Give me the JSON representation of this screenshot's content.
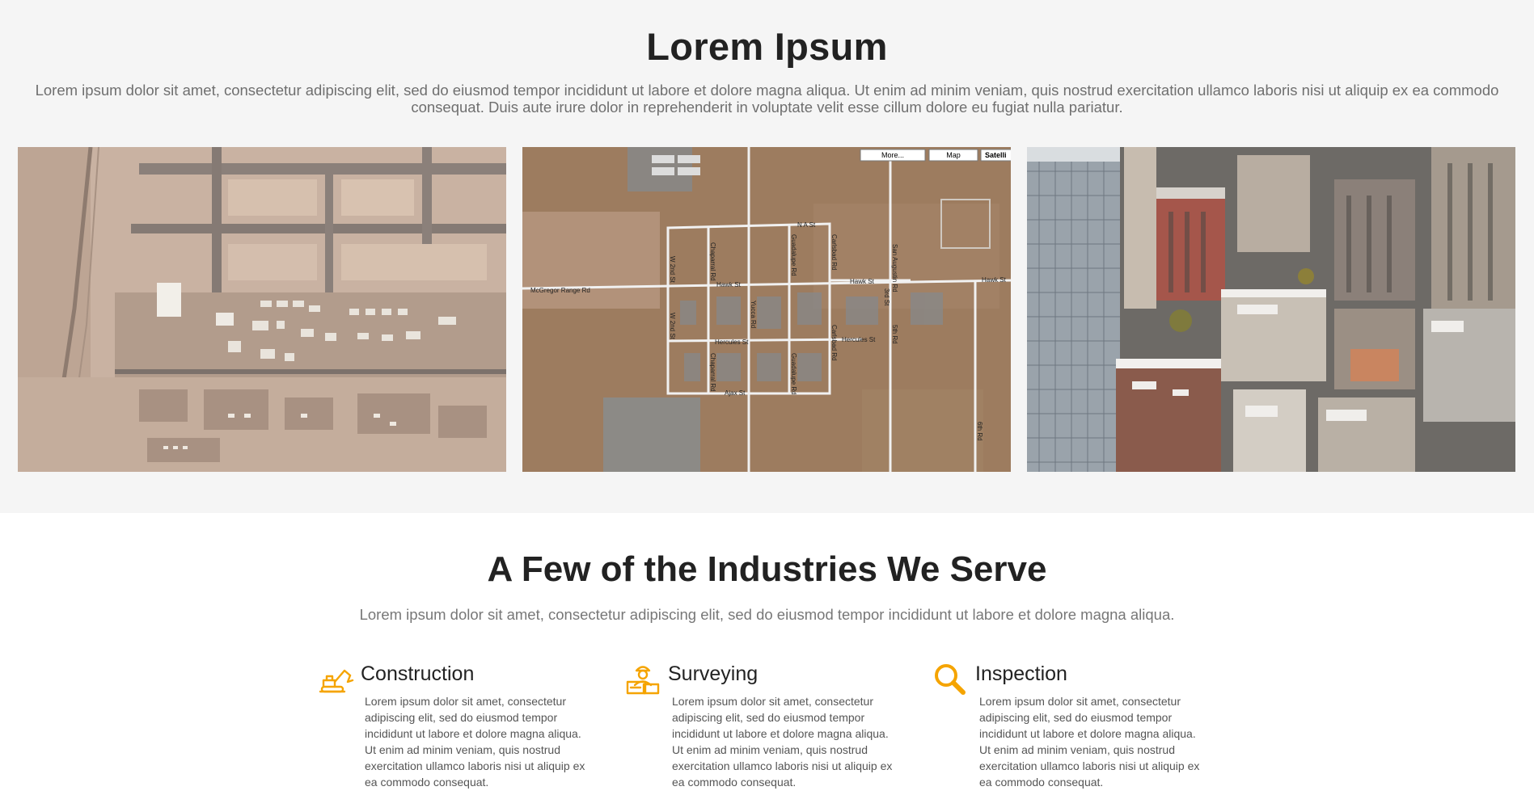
{
  "hero": {
    "title": "Lorem Ipsum",
    "text": "Lorem ipsum dolor sit amet, consectetur adipiscing elit, sed do eiusmod tempor incididunt ut labore et dolore magna aliqua. Ut enim ad minim veniam, quis nostrud exercitation ullamco laboris nisi ut aliquip ex ea commodo consequat. Duis aute irure dolor in reprehenderit in voluptate velit esse cillum dolore eu fugiat nulla pariatur."
  },
  "gallery": {
    "map": {
      "buttons": [
        "More...",
        "Map",
        "Satelli"
      ],
      "labels": [
        "N A St",
        "Hawk St",
        "Hawk St",
        "Hawk St",
        "Hercules St",
        "Hercules St",
        "Ajax St",
        "McGregor Range Rd",
        "W 2nd St",
        "W 2nd St",
        "Chaparral Rd",
        "Chaparral Rd",
        "Guadalupe Rd",
        "Guadalupe Rd",
        "Carlsbad Rd",
        "Carlsbad Rd",
        "Yucca Rd",
        "San Augustin Rd",
        "5th Rd",
        "6th Rd",
        "3rd St"
      ]
    }
  },
  "industries": {
    "title": "A Few of the Industries We Serve",
    "text": "Lorem ipsum dolor sit amet, consectetur adipiscing elit, sed do eiusmod tempor incididunt ut labore et dolore magna aliqua.",
    "accent_color": "#f5a400",
    "items": [
      {
        "icon": "excavator-icon",
        "title": "Construction",
        "text": "Lorem ipsum dolor sit amet, consectetur adipiscing elit, sed do eiusmod tempor incididunt ut labore et dolore magna aliqua. Ut enim ad minim veniam, quis nostrud exercitation ullamco laboris nisi ut aliquip ex ea commodo consequat."
      },
      {
        "icon": "surveyor-icon",
        "title": "Surveying",
        "text": "Lorem ipsum dolor sit amet, consectetur adipiscing elit, sed do eiusmod tempor incididunt ut labore et dolore magna aliqua. Ut enim ad minim veniam, quis nostrud exercitation ullamco laboris nisi ut aliquip ex ea commodo consequat."
      },
      {
        "icon": "magnifier-icon",
        "title": "Inspection",
        "text": "Lorem ipsum dolor sit amet, consectetur adipiscing elit, sed do eiusmod tempor incididunt ut labore et dolore magna aliqua. Ut enim ad minim veniam, quis nostrud exercitation ullamco laboris nisi ut aliquip ex ea commodo consequat."
      }
    ]
  }
}
